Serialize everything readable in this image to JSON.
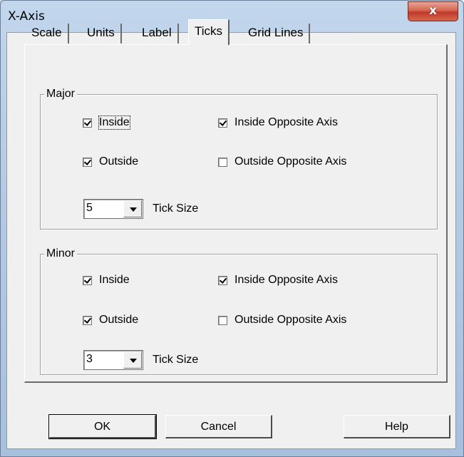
{
  "window": {
    "title": "X-Axis",
    "close_glyph": "x"
  },
  "tabs": [
    {
      "label": "Scale",
      "active": false
    },
    {
      "label": "Units",
      "active": false
    },
    {
      "label": "Label",
      "active": false
    },
    {
      "label": "Ticks",
      "active": true
    },
    {
      "label": "Grid Lines",
      "active": false
    }
  ],
  "major": {
    "title": "Major",
    "inside": {
      "label": "Inside",
      "checked": true
    },
    "outside": {
      "label": "Outside",
      "checked": true
    },
    "inside_opposite": {
      "label": "Inside Opposite Axis",
      "checked": true
    },
    "outside_opposite": {
      "label": "Outside Opposite Axis",
      "checked": false
    },
    "tick_size": {
      "value": "5",
      "label": "Tick Size"
    }
  },
  "minor": {
    "title": "Minor",
    "inside": {
      "label": "Inside",
      "checked": true
    },
    "outside": {
      "label": "Outside",
      "checked": true
    },
    "inside_opposite": {
      "label": "Inside Opposite Axis",
      "checked": true
    },
    "outside_opposite": {
      "label": "Outside Opposite Axis",
      "checked": false
    },
    "tick_size": {
      "value": "3",
      "label": "Tick Size"
    }
  },
  "buttons": {
    "ok": "OK",
    "cancel": "Cancel",
    "help": "Help"
  }
}
